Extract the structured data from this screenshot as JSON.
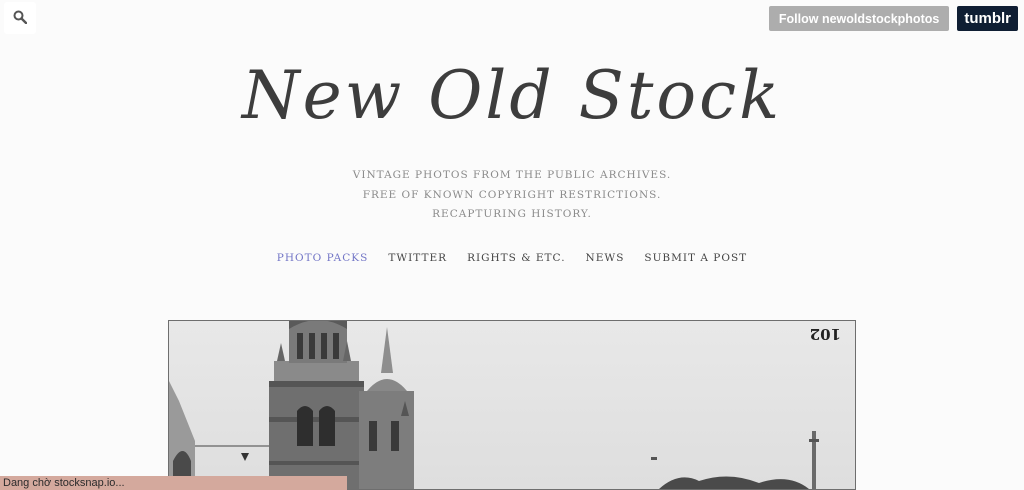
{
  "header": {
    "search_icon": "search-icon",
    "follow_label": "Follow newoldstockphotos",
    "tumblr_label": "tumblr"
  },
  "site": {
    "title": "New Old Stock",
    "tagline": [
      "VINTAGE PHOTOS FROM THE PUBLIC ARCHIVES.",
      "FREE OF KNOWN COPYRIGHT RESTRICTIONS.",
      "RECAPTURING HISTORY."
    ]
  },
  "nav": {
    "items": [
      {
        "label": "PHOTO PACKS",
        "active": true
      },
      {
        "label": "TWITTER",
        "active": false
      },
      {
        "label": "RIGHTS & ETC.",
        "active": false
      },
      {
        "label": "NEWS",
        "active": false
      },
      {
        "label": "SUBMIT A POST",
        "active": false
      }
    ]
  },
  "post": {
    "photo_number": "102"
  },
  "toast": {
    "text": "Dang chờ stocksnap.io..."
  },
  "colors": {
    "active_nav": "#7275c6",
    "tumblr_bg": "#0f1e33",
    "follow_bg": "#adadad",
    "toast_bg": "#d4a99d"
  }
}
